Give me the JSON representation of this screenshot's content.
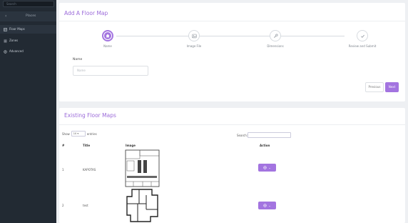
{
  "sidebar": {
    "search_placeholder": "Search",
    "back_label": "Places",
    "items": [
      {
        "label": "Floor Maps",
        "icon": "map-icon"
      },
      {
        "label": "Zones",
        "icon": "list-icon"
      },
      {
        "label": "Advanced",
        "icon": "gear-icon"
      }
    ]
  },
  "wizard": {
    "title": "Add A Floor Map",
    "steps": [
      {
        "label": "Name",
        "icon": "home-icon"
      },
      {
        "label": "Image File",
        "icon": "image-icon"
      },
      {
        "label": "Dimensions",
        "icon": "wrench-icon"
      },
      {
        "label": "Review and Submit",
        "icon": "check-icon"
      }
    ],
    "name_label": "Name",
    "name_placeholder": "Name",
    "previous_label": "Previous",
    "next_label": "Next"
  },
  "existing": {
    "title": "Existing Floor Maps",
    "show_label": "Show",
    "entries_value": "10",
    "entries_label": "entries",
    "search_label": "Search:",
    "columns": [
      "#",
      "Title",
      "Image",
      "Action"
    ],
    "rows": [
      {
        "num": "1",
        "title": "KAPOTAS"
      },
      {
        "num": "2",
        "title": "test"
      }
    ]
  },
  "colors": {
    "accent": "#a374e0",
    "sidebar_bg": "#222a33"
  }
}
